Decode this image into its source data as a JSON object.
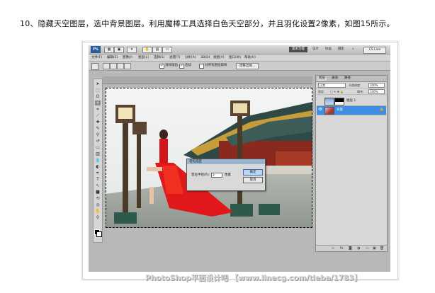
{
  "caption": "10、隐藏天空图层，选中背景图层。利用魔棒工具选择白色天空部分，并且羽化设置2像素，如图15所示。",
  "app": {
    "logo": "Ps",
    "workspace_active": "基本功能",
    "workspaces": [
      "设计",
      "绘画",
      "摄影"
    ],
    "cs_live": "CS Live"
  },
  "menu": [
    "文件(F)",
    "编辑(E)",
    "图像(I)",
    "图层(L)",
    "选择(S)",
    "滤镜(T)",
    "分析(A)",
    "3D(D)",
    "视图(V)",
    "窗口(W)",
    "帮助(H)"
  ],
  "options": {
    "antialias": "消除锯齿",
    "contiguous": "连续",
    "sample_all": "对所有图层取样",
    "refine_edge": "调整边缘..."
  },
  "dialog": {
    "title": "羽化选区",
    "feather_label": "羽化半径(R):",
    "feather_value": "2",
    "unit": "像素",
    "ok": "确定",
    "cancel": "取消"
  },
  "layers_panel": {
    "tabs": [
      "图层",
      "通道",
      "路径"
    ],
    "blend_mode": "正常",
    "opacity_label": "不透明度:",
    "opacity_value": "100%",
    "lock_label": "锁定:",
    "fill_label": "填充:",
    "fill_value": "100%",
    "layers": [
      {
        "name": "图层 1",
        "visible": false,
        "selected": false
      },
      {
        "name": "背景",
        "visible": true,
        "selected": true
      }
    ]
  },
  "watermark": "PhotoShop平面设计吧 【www.linecg.com/tieba/1783】",
  "colors": {
    "selection": "#3d8ee4",
    "workspace_active": "#4c4c4c",
    "dialog_title": "#9ab3cf"
  }
}
